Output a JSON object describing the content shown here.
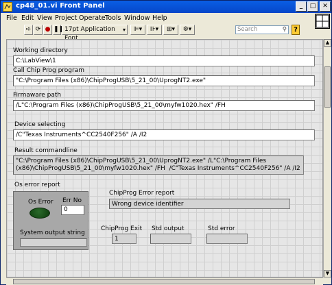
{
  "window": {
    "title": "cp48_01.vi Front Panel"
  },
  "menu": {
    "file": "File",
    "edit": "Edit",
    "view": "View",
    "project": "Project",
    "operate": "Operate",
    "tools": "Tools",
    "window": "Window",
    "help": "Help"
  },
  "toolbar": {
    "font": "17pt Application Font",
    "search_placeholder": "Search"
  },
  "fields": {
    "working_dir": {
      "label": "Working directory",
      "value": "C:\\LabView\\1"
    },
    "chipprog": {
      "label": "Call Chip Prog program",
      "value": "\"C:\\Program Files (x86)\\ChipProgUSB\\5_21_00\\UprogNT2.exe\""
    },
    "firmware": {
      "label": "Firmaware path",
      "value": "/L\"C:\\Program Files (x86)\\ChipProgUSB\\5_21_00\\myfw1020.hex\" /FH"
    },
    "device": {
      "label": "Device selecting",
      "value": "/C\"Texas Instruments^CC2540F256\" /A /I2"
    },
    "result": {
      "label": "Result commandline",
      "value": "\"C:\\Program Files (x86)\\ChipProgUSB\\5_21_00\\UprogNT2.exe\" /L\"C:\\Program Files (x86)\\ChipProgUSB\\5_21_00\\myfw1020.hex\" /FH  /C\"Texas Instruments^CC2540F256\" /A /I2"
    }
  },
  "os_error": {
    "section_label": "Os error report",
    "led_label": "Os Error",
    "errno_label": "Err No",
    "errno_value": "0",
    "sysout_label": "System output string",
    "sysout_value": ""
  },
  "chipprog_error": {
    "label": "ChipProg Error report",
    "value": "Wrong device identifier"
  },
  "exit": {
    "label": "ChipProg Exit",
    "value": "1"
  },
  "std_output": {
    "label": "Std output",
    "value": ""
  },
  "std_error": {
    "label": "Std error",
    "value": ""
  }
}
